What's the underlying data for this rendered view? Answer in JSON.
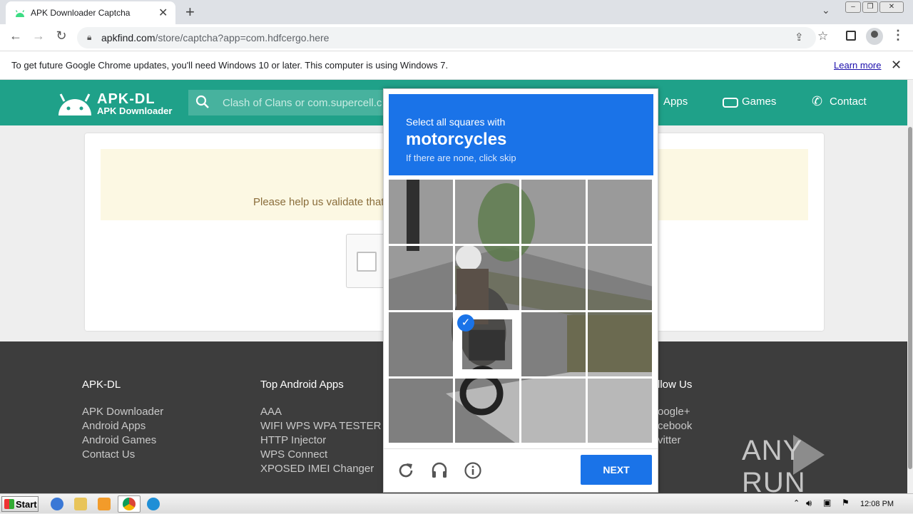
{
  "browser": {
    "tab_title": "APK Downloader Captcha",
    "new_tab_symbol": "+",
    "url_host": "apkfind.com",
    "url_path": "/store/captcha?app=com.hdfcergo.here",
    "infobar_text": "To get future Google Chrome updates, you'll need Windows 10 or later. This computer is using Windows 7.",
    "infobar_link": "Learn more"
  },
  "site": {
    "logo_title": "APK-DL",
    "logo_subtitle": "APK Downloader",
    "search_placeholder": "Clash of Clans or com.supercell.c",
    "nav": {
      "apps": "Apps",
      "games": "Games",
      "contact": "Contact"
    },
    "notice_text": "Please help us validate that",
    "brand_color": "#1fa189"
  },
  "footer": {
    "col1": {
      "title": "APK-DL",
      "links": [
        "APK Downloader",
        "Android Apps",
        "Android Games",
        "Contact Us"
      ]
    },
    "col2": {
      "title": "Top Android Apps",
      "links": [
        "AAA",
        "WIFI WPS WPA TESTER",
        "HTTP Injector",
        "WPS Connect",
        "XPOSED IMEI Changer"
      ]
    },
    "col3": {
      "title": "llow Us",
      "links": [
        "oogle+",
        "cebook",
        "vitter"
      ]
    }
  },
  "captcha": {
    "line1": "Select all squares with",
    "target": "motorcycles",
    "line3": "If there are none, click skip",
    "next_label": "NEXT",
    "accent_color": "#1a73e8",
    "selected_tiles": [
      [
        2,
        1
      ]
    ]
  },
  "watermark": {
    "text_left": "ANY",
    "text_right": "RUN"
  },
  "taskbar": {
    "start_label": "Start",
    "clock": "12:08 PM"
  }
}
